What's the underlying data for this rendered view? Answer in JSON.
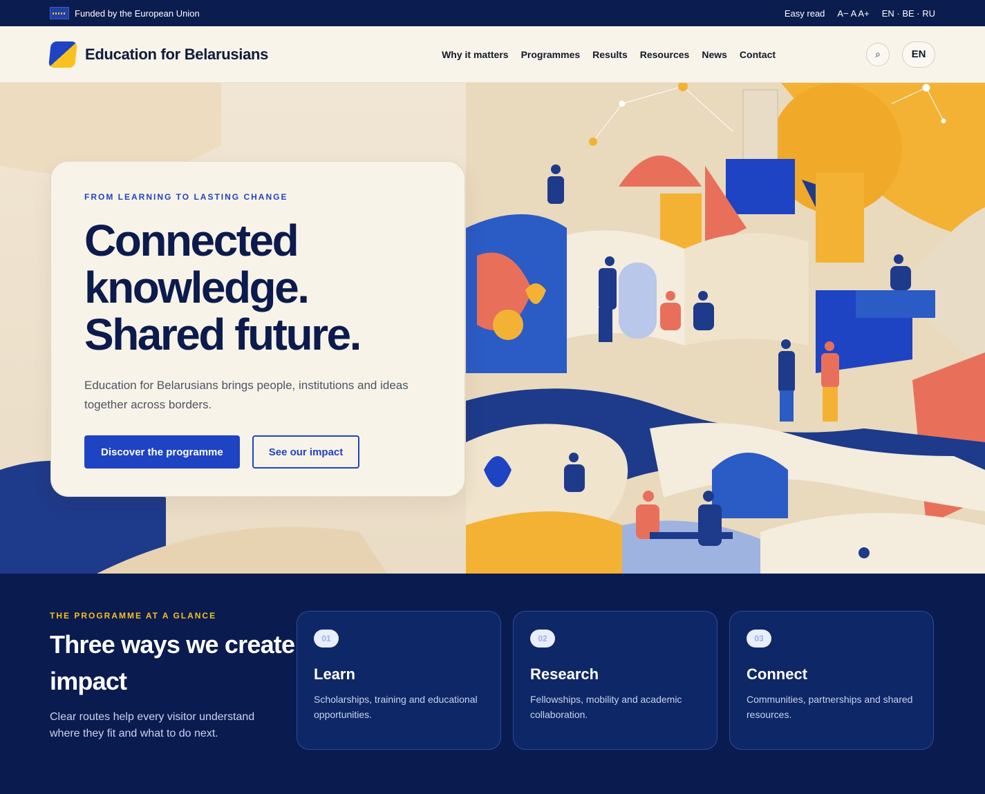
{
  "topbar": {
    "funded_label": "Funded by the European Union",
    "easy_read": "Easy read",
    "font_sizes": "A− A A+",
    "languages": "EN · BE · RU"
  },
  "header": {
    "brand_name": "Education for Belarusians",
    "nav": [
      "Why it matters",
      "Programmes",
      "Results",
      "Resources",
      "News",
      "Contact"
    ],
    "search_icon": "⌕",
    "lang_button": "EN"
  },
  "hero": {
    "eyebrow": "FROM LEARNING TO LASTING CHANGE",
    "title_line1": "Connected",
    "title_line2": "knowledge.",
    "title_line3": "Shared future.",
    "subtitle": "Education for Belarusians brings people, institutions and ideas together across borders.",
    "primary_cta": "Discover the programme",
    "secondary_cta": "See our impact"
  },
  "glance": {
    "eyebrow": "THE PROGRAMME AT A GLANCE",
    "title": "Three ways we create impact",
    "subtitle": "Clear routes help every visitor understand where they fit and what to do next.",
    "cards": [
      {
        "num": "01",
        "title": "Learn",
        "desc": "Scholarships, training and educational opportunities."
      },
      {
        "num": "02",
        "title": "Research",
        "desc": "Fellowships, mobility and academic collaboration."
      },
      {
        "num": "03",
        "title": "Connect",
        "desc": "Communities, partnerships and shared resources."
      }
    ]
  },
  "colors": {
    "navy": "#0a1b4f",
    "blue": "#1e44c4",
    "yellow": "#f7c21f",
    "cream": "#f8f4ea",
    "coral": "#e8705a"
  }
}
